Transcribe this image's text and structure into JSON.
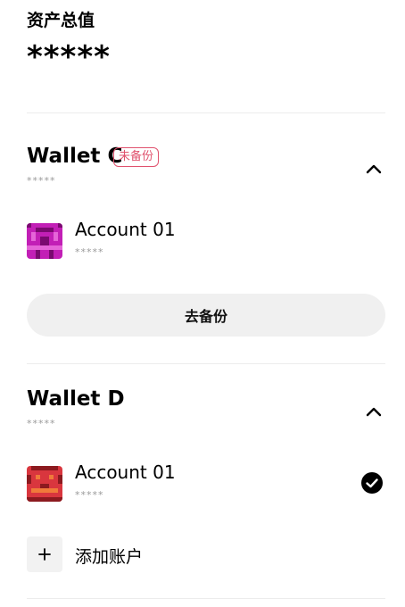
{
  "assets": {
    "label": "资产总值",
    "value": "*****"
  },
  "wallets": [
    {
      "name": "Wallet C",
      "badge": "未备份",
      "balance": "*****",
      "accounts": [
        {
          "name": "Account 01",
          "balance": "*****"
        }
      ],
      "backup_button": "去备份"
    },
    {
      "name": "Wallet D",
      "balance": "*****",
      "accounts": [
        {
          "name": "Account 01",
          "balance": "*****",
          "selected": true
        }
      ],
      "add_account": "添加账户"
    }
  ],
  "colors": {
    "badge": "#e0526e",
    "avatar_c": "#c21fb6",
    "avatar_d": "#d9363e"
  },
  "icons": {
    "collapse": "chevron-up-icon",
    "selected": "check-circle-icon",
    "add": "plus-icon"
  }
}
